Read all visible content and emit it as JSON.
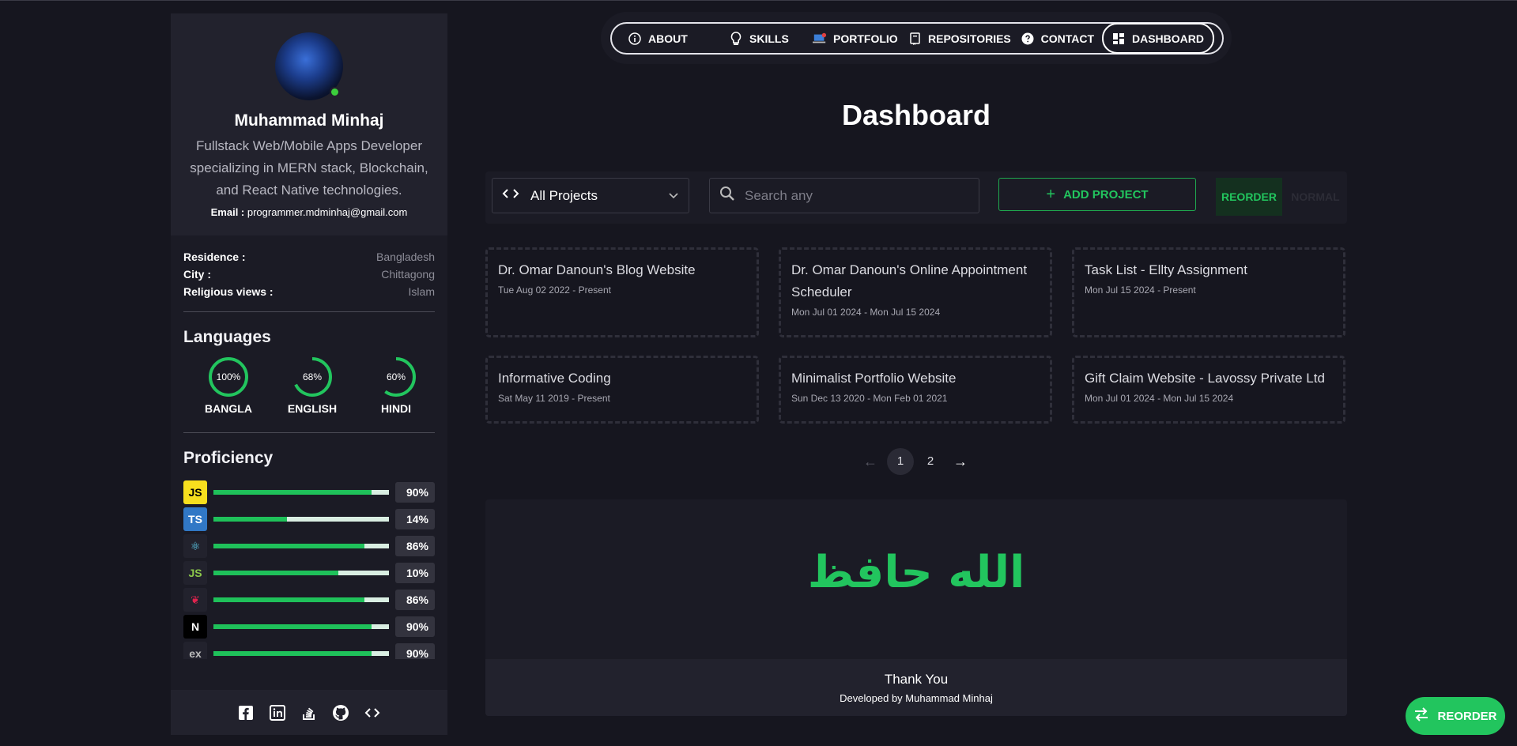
{
  "sidebar": {
    "profile": {
      "name": "Muhammad Minhaj",
      "bio": "Fullstack Web/Mobile Apps Developer specializing in MERN stack, Blockchain, and React Native technologies.",
      "email_label": "Email :",
      "email": "programmer.mdminhaj@gmail.com"
    },
    "info": [
      {
        "key": "Residence :",
        "value": "Bangladesh"
      },
      {
        "key": "City :",
        "value": "Chittagong"
      },
      {
        "key": "Religious views :",
        "value": "Islam"
      }
    ],
    "languages_title": "Languages",
    "languages": [
      {
        "pct_label": "100%",
        "pct": 100,
        "name": "BANGLA"
      },
      {
        "pct_label": "68%",
        "pct": 68,
        "name": "ENGLISH"
      },
      {
        "pct_label": "60%",
        "pct": 60,
        "name": "HINDI"
      }
    ],
    "proficiency_title": "Proficiency",
    "proficiency": [
      {
        "icon": "javascript-icon",
        "glyph": "JS",
        "bg": "#f7df1e",
        "fg": "#000000",
        "pct_label": "90%",
        "pct": 90
      },
      {
        "icon": "typescript-icon",
        "glyph": "TS",
        "bg": "#3178c6",
        "fg": "#ffffff",
        "pct_label": "14%",
        "pct": 42
      },
      {
        "icon": "react-icon",
        "glyph": "⚛",
        "bg": "#22222d",
        "fg": "#61dafb",
        "pct_label": "86%",
        "pct": 86
      },
      {
        "icon": "nodejs-icon",
        "glyph": "JS",
        "bg": "#22222d",
        "fg": "#8cc84b",
        "pct_label": "10%",
        "pct": 71
      },
      {
        "icon": "nestjs-icon",
        "glyph": "❦",
        "bg": "#22222d",
        "fg": "#e0234e",
        "pct_label": "86%",
        "pct": 86
      },
      {
        "icon": "nextjs-icon",
        "glyph": "N",
        "bg": "#000000",
        "fg": "#ffffff",
        "pct_label": "90%",
        "pct": 90
      },
      {
        "icon": "express-icon",
        "glyph": "ex",
        "bg": "#22222d",
        "fg": "#bbbbbb",
        "pct_label": "90%",
        "pct": 90
      }
    ]
  },
  "nav": {
    "items": [
      {
        "label": "ABOUT",
        "icon": "info-icon",
        "glyph": "ⓘ"
      },
      {
        "label": "SKILLS",
        "icon": "lightbulb-icon",
        "glyph": "💡"
      },
      {
        "label": "PORTFOLIO",
        "icon": "laptop-icon",
        "glyph": "💻"
      },
      {
        "label": "REPOSITORIES",
        "icon": "repository-icon",
        "glyph": "⧉"
      },
      {
        "label": "CONTACT",
        "icon": "help-icon",
        "glyph": "?"
      },
      {
        "label": "DASHBOARD",
        "icon": "dashboard-icon",
        "glyph": "▦"
      }
    ]
  },
  "main": {
    "title": "Dashboard",
    "toolbar": {
      "select_value": "All Projects",
      "search_placeholder": "Search any",
      "add_label": "ADD PROJECT",
      "reorder_label": "REORDER",
      "normal_label": "NORMAL"
    },
    "projects": [
      {
        "title": "Dr. Omar Danoun's Blog Website",
        "date": "Tue Aug 02 2022 - Present"
      },
      {
        "title": "Dr. Omar Danoun's Online Appointment Scheduler",
        "date": "Mon Jul 01 2024 - Mon Jul 15 2024"
      },
      {
        "title": "Task List - Ellty Assignment",
        "date": "Mon Jul 15 2024 - Present"
      },
      {
        "title": "Informative Coding",
        "date": "Sat May 11 2019 - Present"
      },
      {
        "title": "Minimalist Portfolio Website",
        "date": "Sun Dec 13 2020 - Mon Feb 01 2021"
      },
      {
        "title": "Gift Claim Website - Lavossy Private Ltd",
        "date": "Mon Jul 01 2024 - Mon Jul 15 2024"
      }
    ],
    "pagination": {
      "prev": "←",
      "pages": [
        "1",
        "2"
      ],
      "current": "1",
      "next": "→"
    },
    "footer": {
      "arabic": "الله حافظ",
      "thank_you": "Thank You",
      "developed_by": "Developed by Muhammad Minhaj"
    }
  },
  "fab": {
    "label": "REORDER"
  },
  "colors": {
    "accent": "#22c55e",
    "background": "#16161f",
    "card": "#1b1b25"
  }
}
